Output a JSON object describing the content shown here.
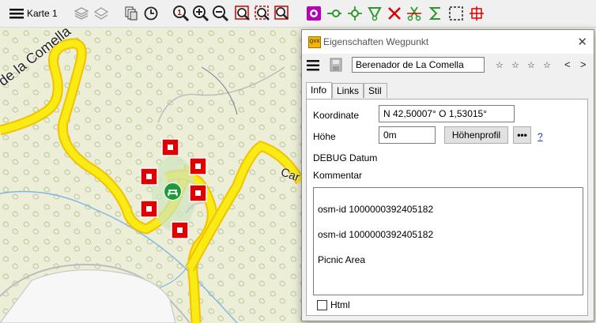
{
  "toolbar": {
    "map_label": "Karte 1",
    "icons": [
      "menu-icon",
      "layers-icon",
      "layers-alt-icon",
      "stack-icon",
      "history-icon",
      "zoom-one-icon",
      "zoom-in-icon",
      "zoom-out-icon",
      "zoom-rect-icon",
      "zoom-select-icon",
      "zoom-fit-icon",
      "waypoint-icon",
      "route-icon",
      "point-icon",
      "filter-icon",
      "delete-icon",
      "cut-icon",
      "sum-icon",
      "select-rect-icon",
      "crosshair-icon"
    ]
  },
  "map": {
    "labels": [
      "de la Comella",
      "Car"
    ],
    "poi_icon": "picnic-icon",
    "colors": {
      "road": "#f9e000",
      "road_outline": "#f2c100",
      "background": "#eef0dc",
      "marker": "#e00000",
      "water": "#7fb4e8",
      "poi": "#1e9a3a"
    }
  },
  "dialog": {
    "title": "Eigenschaften Wegpunkt",
    "name_value": "Berenador de La Comella",
    "stars": [
      "☆",
      "☆",
      "☆",
      "☆"
    ],
    "nav_prev": "<",
    "nav_next": ">",
    "tabs": [
      "Info",
      "Links",
      "Stil"
    ],
    "active_tab": "Info",
    "coordinate_label": "Koordinate",
    "coordinate_value": "N 42,50007° O 1,53015°",
    "elevation_label": "Höhe",
    "elevation_value": "0m",
    "profile_button": "Höhenprofil",
    "more_button": "•••",
    "help_link": "?",
    "debug_label": "DEBUG Datum",
    "comment_label": "Kommentar",
    "comment_lines": [
      "osm-id 1000000392405182",
      "osm-id 1000000392405182",
      "Picnic Area"
    ],
    "html_label": "Html"
  }
}
